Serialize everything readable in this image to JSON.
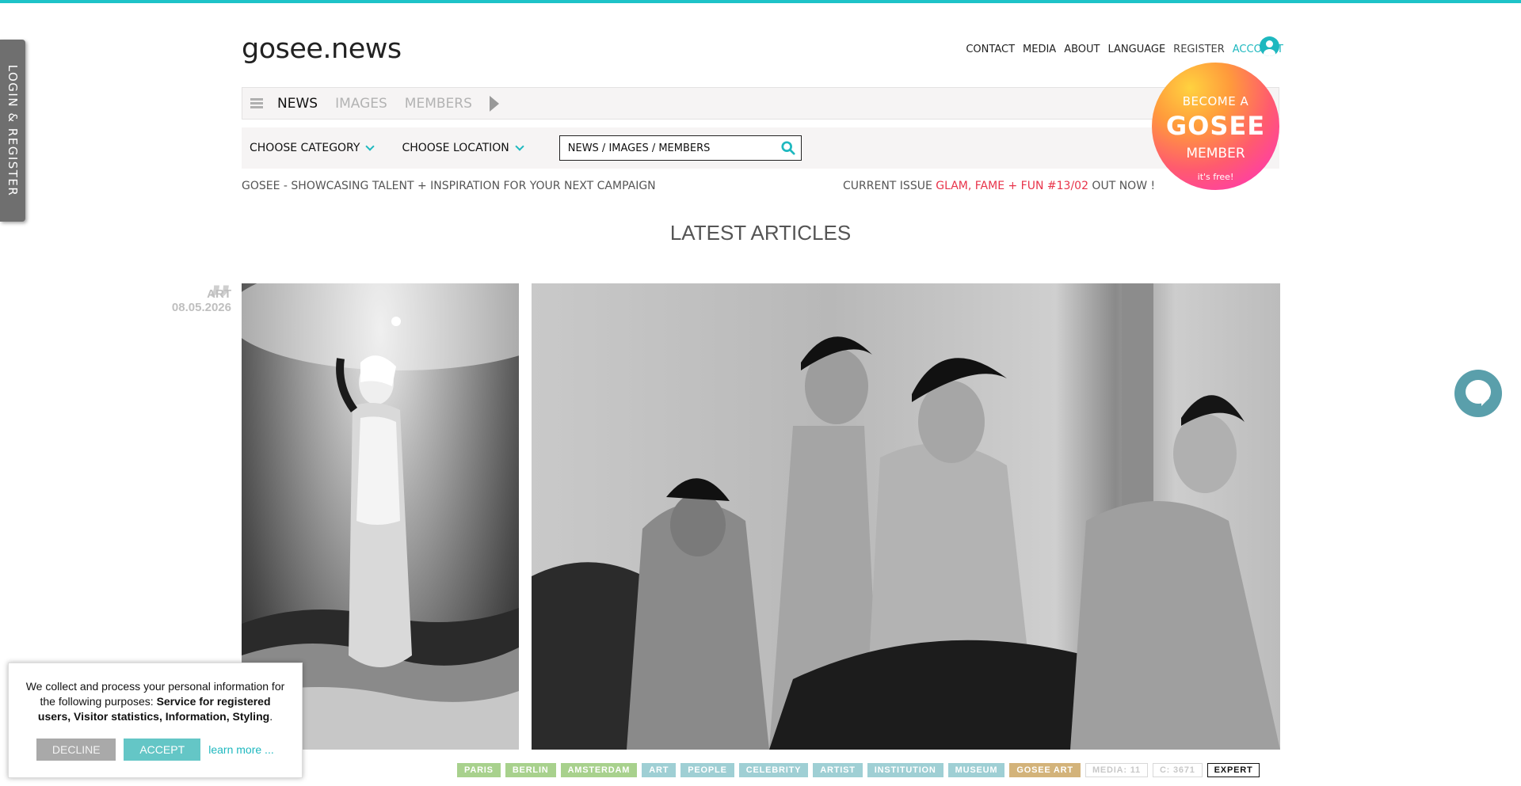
{
  "colors": {
    "accent": "#1eb8bf",
    "highlight": "#e8334a",
    "badge_gradient": "#ff9a3c-#ff3ea5"
  },
  "side_tab": {
    "label": "LOGIN & REGISTER"
  },
  "header": {
    "logo": "gosee.news",
    "nav": [
      "CONTACT",
      "MEDIA",
      "ABOUT",
      "LANGUAGE",
      "REGISTER",
      "ACCOUNT"
    ]
  },
  "tabs": [
    {
      "label": "NEWS",
      "active": true
    },
    {
      "label": "IMAGES",
      "active": false
    },
    {
      "label": "MEMBERS",
      "active": false
    }
  ],
  "filters": {
    "category": "CHOOSE CATEGORY",
    "location": "CHOOSE LOCATION",
    "search_placeholder": "NEWS / IMAGES / MEMBERS"
  },
  "tagline": "GOSEE - SHOWCASING TALENT + INSPIRATION FOR YOUR NEXT CAMPAIGN",
  "issue": {
    "prefix": "CURRENT ISSUE ",
    "title": "GLAM, FAME + FUN #13/02",
    "suffix": " OUT NOW !"
  },
  "badge": {
    "line1": "BECOME A",
    "line2": "GOSEE",
    "line3": "MEMBER",
    "line4": "it's free!"
  },
  "section_title": "LATEST ARTICLES",
  "article": {
    "category": "ART",
    "date": "08.05.2026",
    "tags": [
      {
        "label": "PARIS",
        "style": "g"
      },
      {
        "label": "BERLIN",
        "style": "g"
      },
      {
        "label": "AMSTERDAM",
        "style": "g"
      },
      {
        "label": "ART",
        "style": "b"
      },
      {
        "label": "PEOPLE",
        "style": "b"
      },
      {
        "label": "CELEBRITY",
        "style": "b"
      },
      {
        "label": "ARTIST",
        "style": "b"
      },
      {
        "label": "INSTITUTION",
        "style": "b"
      },
      {
        "label": "MUSEUM",
        "style": "b"
      },
      {
        "label": "GOSEE ART",
        "style": "o"
      },
      {
        "label": "MEDIA: 11",
        "style": "outline"
      },
      {
        "label": "C: 3671",
        "style": "outline"
      },
      {
        "label": "EXPERT",
        "style": "expert"
      }
    ]
  },
  "cookie": {
    "text_plain": "We collect and process your personal information for the following purposes: ",
    "text_bold": "Service for registered users, Visitor statistics, Information, Styling",
    "text_end": ".",
    "decline": "DECLINE",
    "accept": "ACCEPT",
    "learn_more": "learn more ..."
  }
}
